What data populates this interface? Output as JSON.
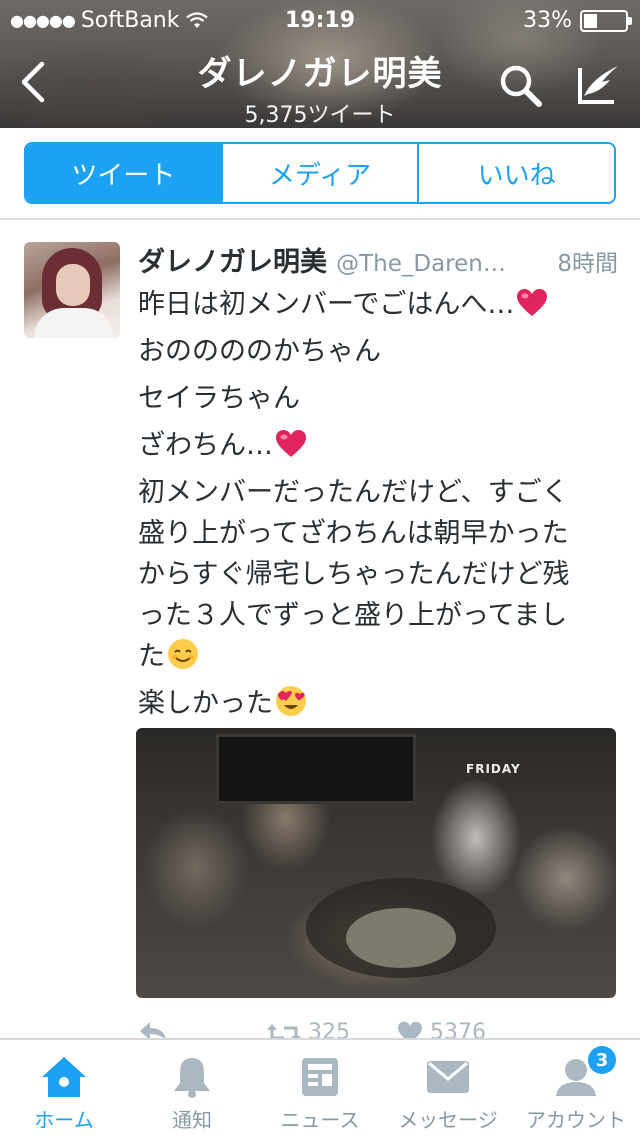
{
  "status_bar": {
    "dots": "●●●●●",
    "carrier": "SoftBank",
    "time": "19:19",
    "battery_percent_label": "33%",
    "battery_level": 0.33
  },
  "nav": {
    "title": "ダレノガレ明美",
    "subtitle": "5,375ツイート",
    "icons": [
      "back-chevron-icon",
      "search-icon",
      "compose-icon"
    ]
  },
  "segments": [
    {
      "label": "ツイート",
      "active": true
    },
    {
      "label": "メディア",
      "active": false
    },
    {
      "label": "いいね",
      "active": false
    }
  ],
  "tweet": {
    "name": "ダレノガレ明美",
    "handle": "@The_Daren…",
    "time": "8時間",
    "lines": [
      "昨日は初メンバーでごはんへ…",
      "おののののかちゃん",
      "セイラちゃん",
      "ざわちん…",
      "初メンバーだったんだけど、すごく",
      "盛り上がってざわちんは朝早かった",
      "からすぐ帰宅しちゃったんだけど残",
      "った３人でずっと盛り上がってまし",
      "た",
      "楽しかった"
    ],
    "media_hat_text": "FRIDAY",
    "actions": {
      "retweets": "325",
      "likes": "5376"
    },
    "colors": {
      "heart": "#e0245e",
      "link": "#1da1f2"
    }
  },
  "tabbar": {
    "items": [
      {
        "label": "ホーム",
        "icon": "home-icon",
        "active": true
      },
      {
        "label": "通知",
        "icon": "bell-icon",
        "active": false
      },
      {
        "label": "ニュース",
        "icon": "news-icon",
        "active": false
      },
      {
        "label": "メッセージ",
        "icon": "envelope-icon",
        "active": false
      },
      {
        "label": "アカウント",
        "icon": "person-icon",
        "active": false
      }
    ],
    "account_badge": "3"
  }
}
